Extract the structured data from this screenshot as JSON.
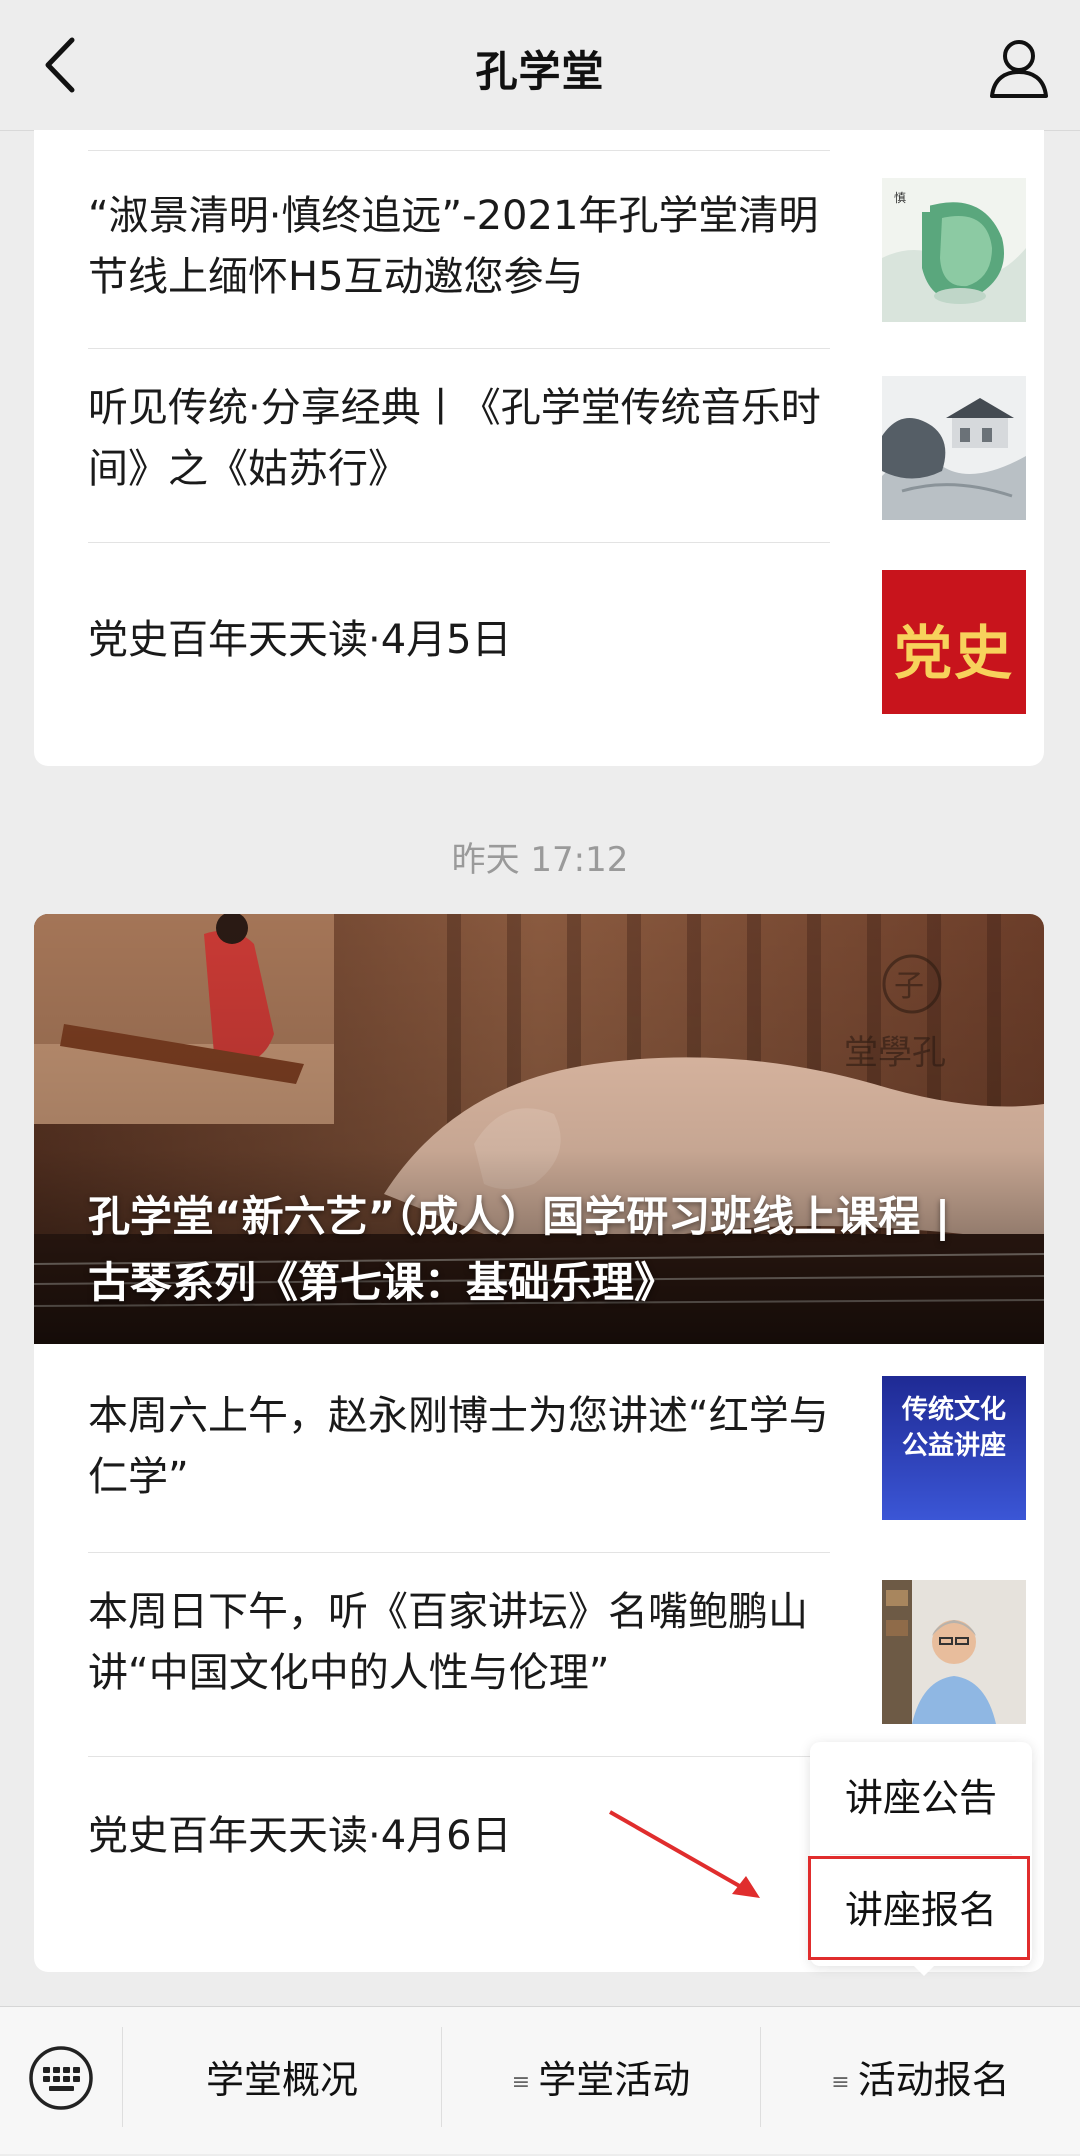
{
  "nav": {
    "title": "孔学堂"
  },
  "card1": {
    "items": [
      {
        "title": "“淑景清明·慎终追远”-2021年孔学堂清明节线上缅怀H5互动邀您参与"
      },
      {
        "title": "听见传统·分享经典丨《孔学堂传统音乐时间》之《姑苏行》"
      },
      {
        "title": "党史百年天天读·4月5日",
        "thumb_text": "党史"
      }
    ]
  },
  "time_divider": "昨天 17:12",
  "card2": {
    "hero_title": "孔学堂“新六艺”（成人）国学研习班线上课程 | 古琴系列《第七课：基础乐理》",
    "items": [
      {
        "title": "本周六上午，赵永刚博士为您讲述“红学与仁学”",
        "thumb_text": [
          "传统文化",
          "公益讲座"
        ]
      },
      {
        "title": "本周日下午，听《百家讲坛》名嘴鲍鹏山讲“中国文化中的人性与伦理”"
      },
      {
        "title": "党史百年天天读·4月6日"
      }
    ]
  },
  "popup_menu": {
    "items": [
      {
        "label": "讲座公告"
      },
      {
        "label": "讲座报名"
      }
    ],
    "highlight_color": "#e02d2d"
  },
  "bottom_menu": {
    "tabs": [
      {
        "label": "学堂概况"
      },
      {
        "label": "学堂活动"
      },
      {
        "label": "活动报名"
      }
    ]
  },
  "colors": {
    "background": "#ededed",
    "annotation": "#e02d2d"
  }
}
